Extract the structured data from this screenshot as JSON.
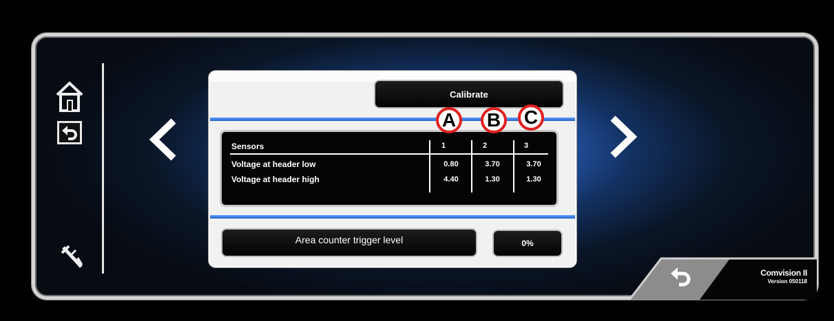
{
  "header": {
    "calibrate_label": "Calibrate"
  },
  "markers": [
    "A",
    "B",
    "C"
  ],
  "table": {
    "headers": [
      "Sensors",
      "1",
      "2",
      "3"
    ],
    "rows": [
      {
        "label": "Voltage at header low",
        "values": [
          "0.80",
          "3.70",
          "3.70"
        ]
      },
      {
        "label": "Voltage at header high",
        "values": [
          "4.40",
          "1.30",
          "1.30"
        ]
      }
    ]
  },
  "area_counter": {
    "label": "Area counter trigger level",
    "value": "0%"
  },
  "brand": {
    "name": "Comvision II",
    "version": "Version 050118"
  },
  "icons": {
    "home": "home-icon",
    "back": "back-icon",
    "tool": "caliper-icon",
    "prev": "chevron-left-icon",
    "next": "chevron-right-icon",
    "return": "return-icon"
  },
  "colors": {
    "accent_blue": "#2a62c8",
    "marker_red": "#e02020"
  }
}
